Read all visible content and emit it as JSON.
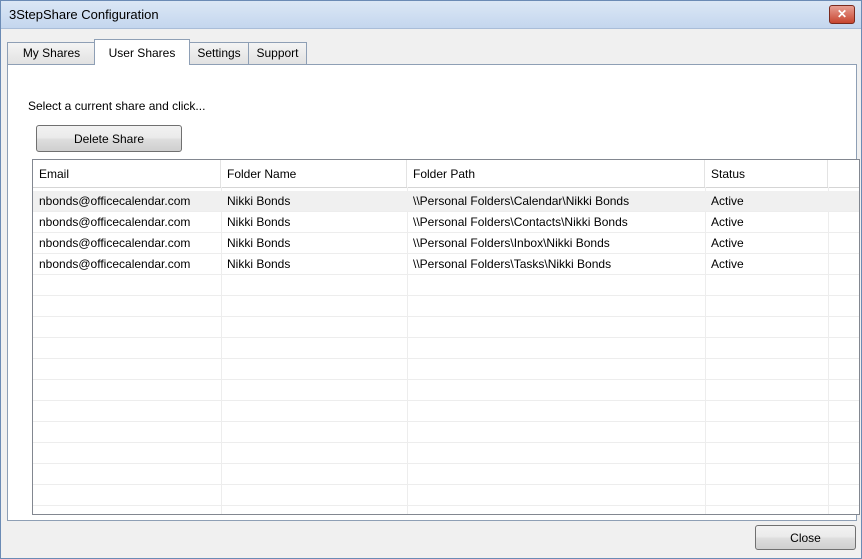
{
  "window": {
    "title": "3StepShare Configuration",
    "close_glyph": "✕"
  },
  "tabs": [
    {
      "label": "My Shares",
      "active": false
    },
    {
      "label": "User Shares",
      "active": true
    },
    {
      "label": "Settings",
      "active": false
    },
    {
      "label": "Support",
      "active": false
    }
  ],
  "panel": {
    "instruction": "Select a current share and click...",
    "delete_button": "Delete Share"
  },
  "table": {
    "columns": [
      "Email",
      "Folder Name",
      "Folder Path",
      "Status"
    ],
    "rows": [
      [
        "nbonds@officecalendar.com",
        "Nikki Bonds",
        "\\\\Personal Folders\\Calendar\\Nikki Bonds",
        "Active"
      ],
      [
        "nbonds@officecalendar.com",
        "Nikki Bonds",
        "\\\\Personal Folders\\Contacts\\Nikki Bonds",
        "Active"
      ],
      [
        "nbonds@officecalendar.com",
        "Nikki Bonds",
        "\\\\Personal Folders\\Inbox\\Nikki Bonds",
        "Active"
      ],
      [
        "nbonds@officecalendar.com",
        "Nikki Bonds",
        "\\\\Personal Folders\\Tasks\\Nikki Bonds",
        "Active"
      ]
    ]
  },
  "footer": {
    "close_button": "Close"
  }
}
